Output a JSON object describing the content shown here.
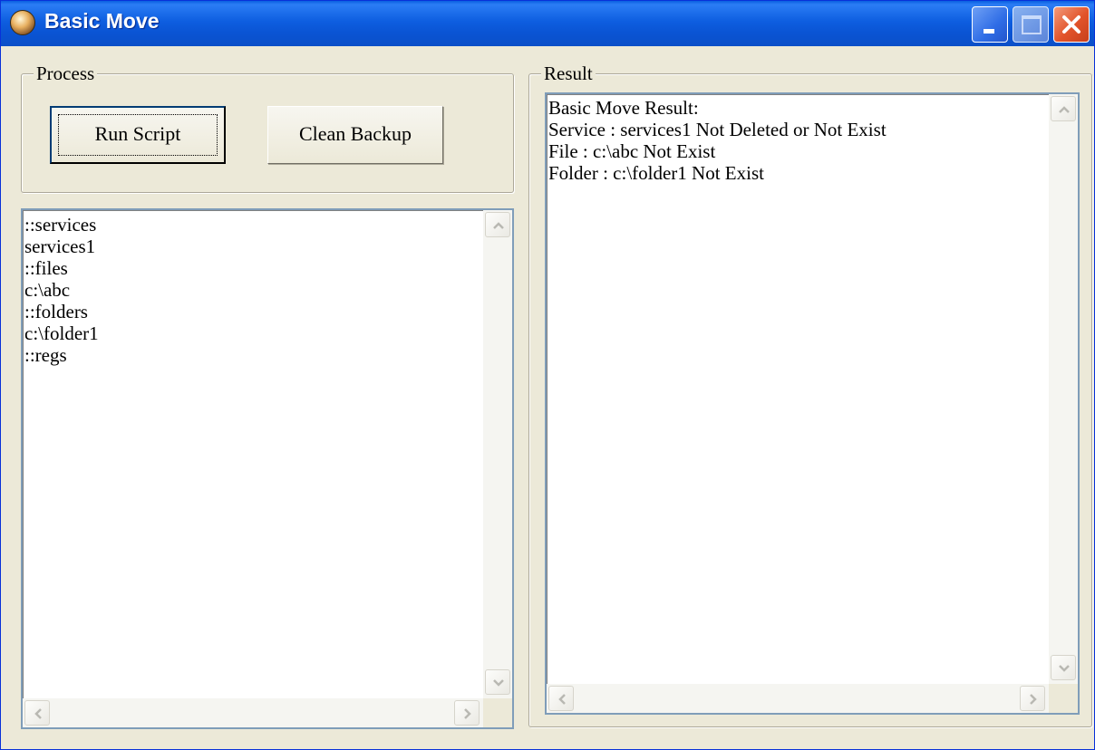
{
  "window": {
    "title": "Basic Move",
    "accent": "#0a54d4"
  },
  "controls": {
    "minimize": "minimize-icon",
    "maximize": "maximize-icon",
    "close": "close-icon"
  },
  "process": {
    "label": "Process",
    "run_script": "Run Script",
    "clean_backup": "Clean Backup"
  },
  "script_text": "::services\nservices1\n::files\nc:\\abc\n::folders\nc:\\folder1\n::regs",
  "result": {
    "label": "Result",
    "text": "Basic Move Result:\nService : services1 Not Deleted or Not Exist\nFile : c:\\abc Not Exist\nFolder : c:\\folder1 Not Exist"
  }
}
